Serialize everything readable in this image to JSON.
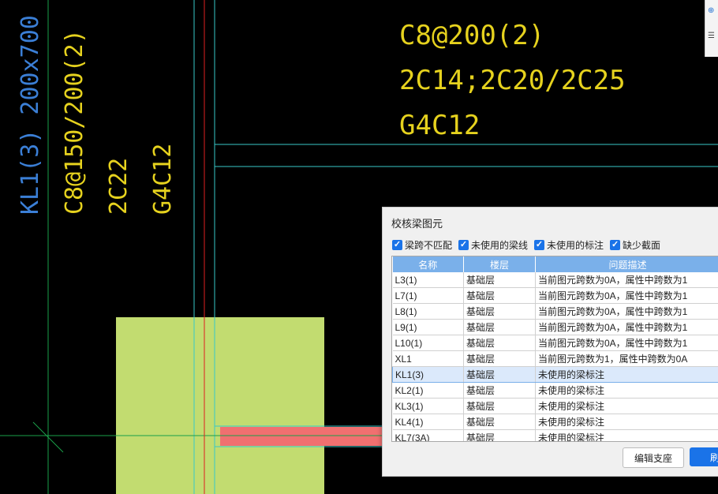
{
  "canvas": {
    "annotations_top": [
      "C8@200(2)",
      "2C14;2C20/2C25",
      "G4C12"
    ],
    "annotations_left": [
      "KL1(3) 200x700",
      "C8@150/200(2)",
      "2C22",
      "G4C12"
    ],
    "colors": {
      "background": "#000000",
      "yellow": "#e6d21e",
      "blue": "#3b7fd6",
      "cyan": "#38c8c8",
      "red": "#e02020",
      "green": "#1aa04a",
      "column_fill": "#c2dc70",
      "beam_highlight": "#f07070"
    }
  },
  "toolbar": {
    "icons": [
      "zoom-icon",
      "list-icon"
    ]
  },
  "dialog": {
    "title": "校核梁图元",
    "filters": [
      {
        "label": "梁跨不匹配",
        "checked": true
      },
      {
        "label": "未使用的梁线",
        "checked": true
      },
      {
        "label": "未使用的标注",
        "checked": true
      },
      {
        "label": "缺少截面",
        "checked": true
      }
    ],
    "columns": [
      "名称",
      "楼层",
      "问题描述"
    ],
    "rows": [
      {
        "name": "L3(1)",
        "floor": "基础层",
        "desc": "当前图元跨数为0A，属性中跨数为1"
      },
      {
        "name": "L7(1)",
        "floor": "基础层",
        "desc": "当前图元跨数为0A，属性中跨数为1"
      },
      {
        "name": "L8(1)",
        "floor": "基础层",
        "desc": "当前图元跨数为0A，属性中跨数为1"
      },
      {
        "name": "L9(1)",
        "floor": "基础层",
        "desc": "当前图元跨数为0A，属性中跨数为1"
      },
      {
        "name": "L10(1)",
        "floor": "基础层",
        "desc": "当前图元跨数为0A，属性中跨数为1"
      },
      {
        "name": "XL1",
        "floor": "基础层",
        "desc": "当前图元跨数为1，属性中跨数为0A"
      },
      {
        "name": "KL1(3)",
        "floor": "基础层",
        "desc": "未使用的梁标注",
        "selected": true
      },
      {
        "name": "KL2(1)",
        "floor": "基础层",
        "desc": "未使用的梁标注"
      },
      {
        "name": "KL3(1)",
        "floor": "基础层",
        "desc": "未使用的梁标注"
      },
      {
        "name": "KL4(1)",
        "floor": "基础层",
        "desc": "未使用的梁标注"
      },
      {
        "name": "KL7(3A)",
        "floor": "基础层",
        "desc": "未使用的梁标注"
      }
    ],
    "buttons": {
      "edit_support": "编辑支座",
      "refresh": "刷"
    }
  }
}
